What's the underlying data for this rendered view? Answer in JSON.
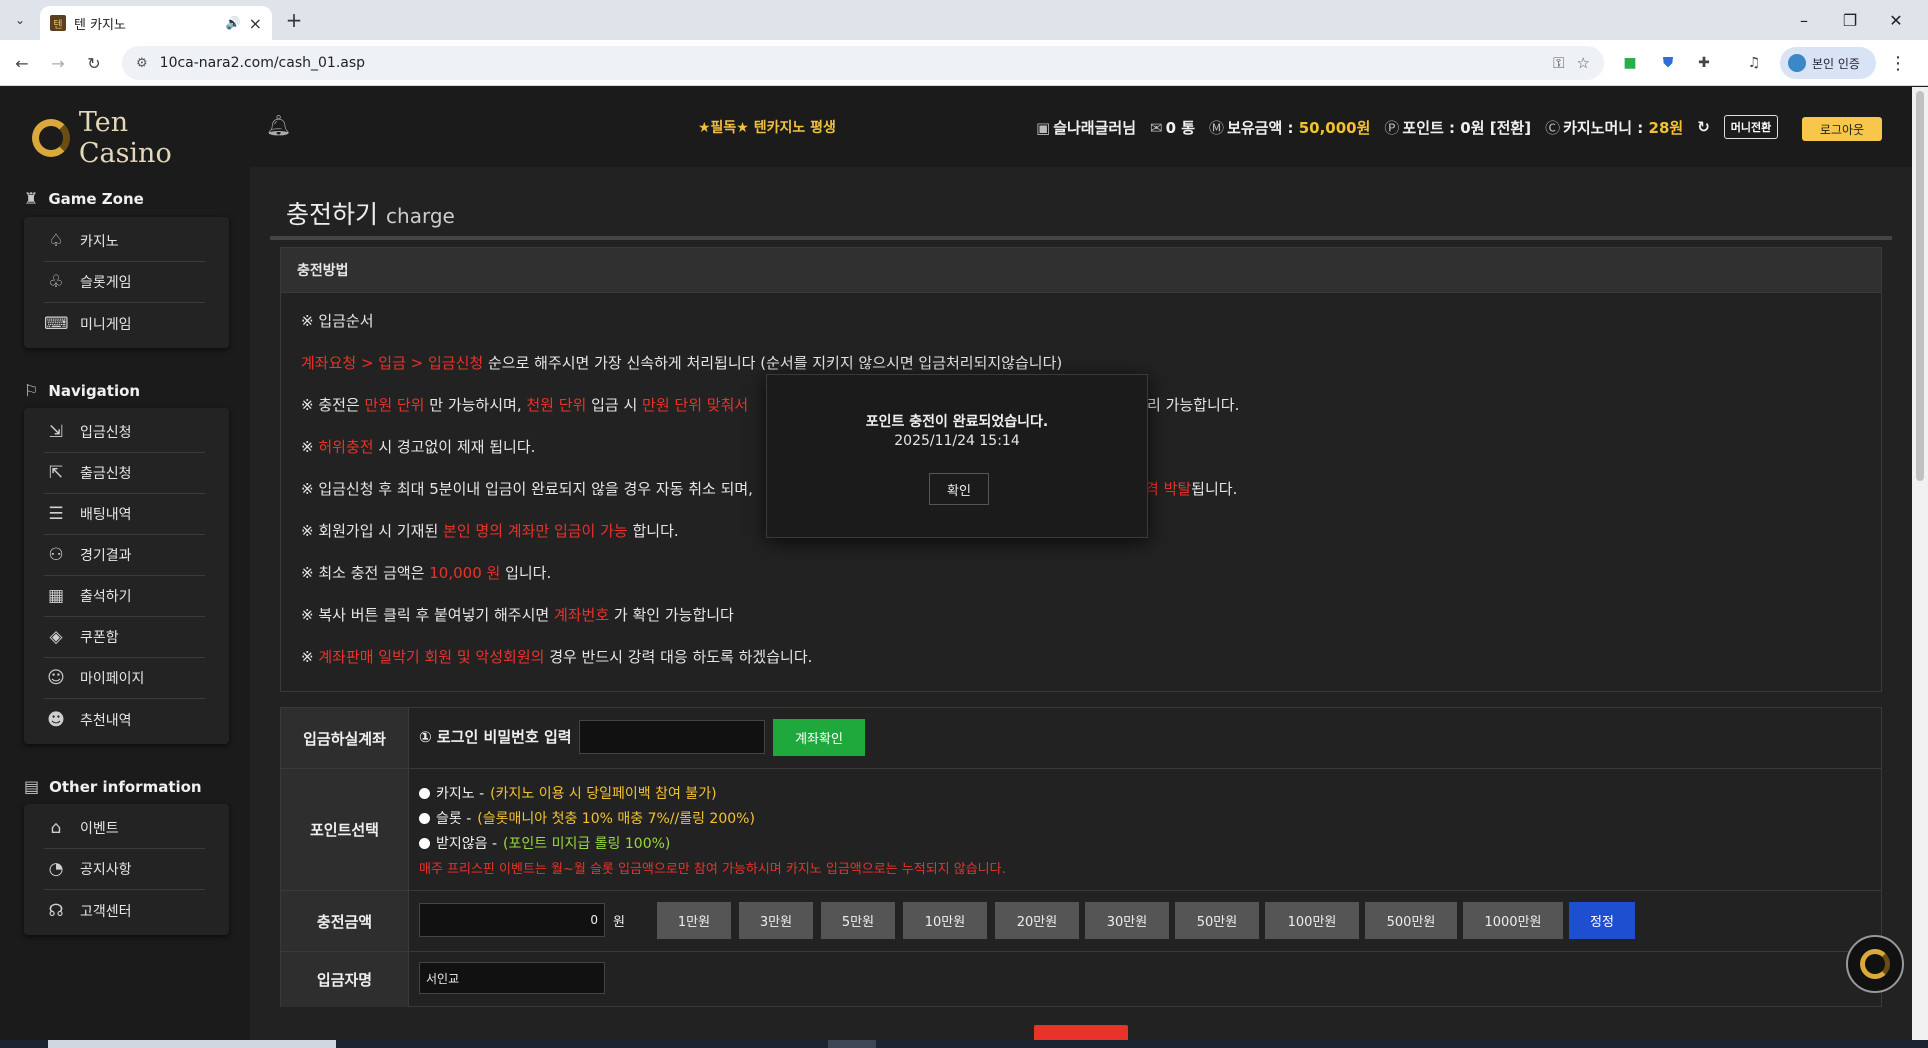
{
  "browser": {
    "tab_title": "텐 카지노",
    "tab_favicon": "텐",
    "url": "10ca-nara2.com/cash_01.asp",
    "profile_label": "본인 인증"
  },
  "site": {
    "logo_text": "Ten Casino",
    "marquee": "★필독★ 텐카지노 평생"
  },
  "user": {
    "username": "슬나래글러님",
    "messages": "0 통",
    "balance_label": "보유금액 : ",
    "balance_value": "50,000원",
    "points_label": "포인트 : 0원",
    "points_convert": "[전환]",
    "casino_money_label": "카지노머니 : ",
    "casino_money_value": "28원",
    "money_convert": "머니전환",
    "logout": "로그아웃"
  },
  "sidebar": {
    "game_zone": {
      "title": "Game Zone",
      "items": [
        {
          "label": "카지노",
          "icon": "spade-icon"
        },
        {
          "label": "슬롯게임",
          "icon": "cherry-icon"
        },
        {
          "label": "미니게임",
          "icon": "gamepad-icon"
        }
      ]
    },
    "navigation": {
      "title": "Navigation",
      "items": [
        {
          "label": "입금신청",
          "icon": "deposit-icon"
        },
        {
          "label": "출금신청",
          "icon": "withdraw-icon"
        },
        {
          "label": "배팅내역",
          "icon": "betting-history-icon"
        },
        {
          "label": "경기결과",
          "icon": "results-icon"
        },
        {
          "label": "출석하기",
          "icon": "calendar-icon"
        },
        {
          "label": "쿠폰함",
          "icon": "coupon-icon"
        },
        {
          "label": "마이페이지",
          "icon": "user-icon"
        },
        {
          "label": "추천내역",
          "icon": "referral-icon"
        }
      ]
    },
    "other": {
      "title": "Other information",
      "items": [
        {
          "label": "이벤트",
          "icon": "gift-icon"
        },
        {
          "label": "공지사항",
          "icon": "announcement-icon"
        },
        {
          "label": "고객센터",
          "icon": "support-icon"
        }
      ]
    }
  },
  "page": {
    "title": "충전하기",
    "subtitle": "charge"
  },
  "method": {
    "header": "충전방법",
    "line1": "※ 입금순서",
    "line2_red": "계좌요청 > 입금 > 입금신청",
    "line2_rest": " 순으로 해주시면 가장 신속하게 처리됩니다 (순서를 지키지 않으시면 입금처리되지않습니다)",
    "line3_a": "※ 충전은 ",
    "line3_b": "만원 단위",
    "line3_c": " 만 가능하시며, ",
    "line3_d": "천원 단위",
    "line3_e": " 입금 시 ",
    "line3_f": "만원 단위 맞춰서",
    "line3_tail": "리 가능합니다.",
    "line4_a": "※ ",
    "line4_b": "허위충전",
    "line4_c": " 시 경고없이 제재 됩니다.",
    "line5_a": "※ 입금신청 후 최대 5분이내 입금이 완료되지 않을 경우 자동 취소 되며,",
    "line5_red": "격 박탈",
    "line5_tail": "됩니다.",
    "line6_a": "※ 회원가입 시 기재된 ",
    "line6_b": "본인 명의 계좌만 입금이 가능",
    "line6_c": " 합니다.",
    "line7_a": "※ 최소 충전 금액은 ",
    "line7_b": "10,000 원",
    "line7_c": " 입니다.",
    "line8_a": "※ 복사 버튼 클릭 후 붙여넣기 해주시면 ",
    "line8_b": "계좌번호",
    "line8_c": " 가 확인 가능합니다",
    "line9_a": "※ ",
    "line9_b": "계좌판매 일박기 회원 및 악성회원의",
    "line9_c": " 경우 반드시 강력 대응 하도록 하겠습니다."
  },
  "form": {
    "account_label": "입금하실계좌",
    "pw_label": "① 로그인 비밀번호 입력",
    "check_button": "계좌확인",
    "points_label": "포인트선택",
    "opt1_name": "카지노 - ",
    "opt1_desc": "(카지노 이용 시 당일페이백 참여 불가)",
    "opt2_name": "슬롯 - ",
    "opt2_desc": "(슬롯매니아 첫충 10% 매충 7%//롤링 200%)",
    "opt3_name": "받지않음 - ",
    "opt3_desc": "(포인트 미지급 롤링 100%)",
    "notice": "매주 프리스핀 이벤트는 월~월 슬롯 입금액으로만 참여 가능하시며 카지노 입금액으로는 누적되지 않습니다.",
    "amount_label": "충전금액",
    "amount_value": "0",
    "won": "원",
    "amount_buttons": [
      "1만원",
      "3만원",
      "5만원",
      "10만원",
      "20만원",
      "30만원",
      "50만원",
      "100만원",
      "500만원",
      "1000만원"
    ],
    "reset_button": "정정",
    "depositor_label": "입금자명",
    "depositor_value": "서인교"
  },
  "modal": {
    "message": "포인트 충전이 완료되었습니다.",
    "datetime": "2025/11/24 15:14",
    "ok": "확인"
  }
}
